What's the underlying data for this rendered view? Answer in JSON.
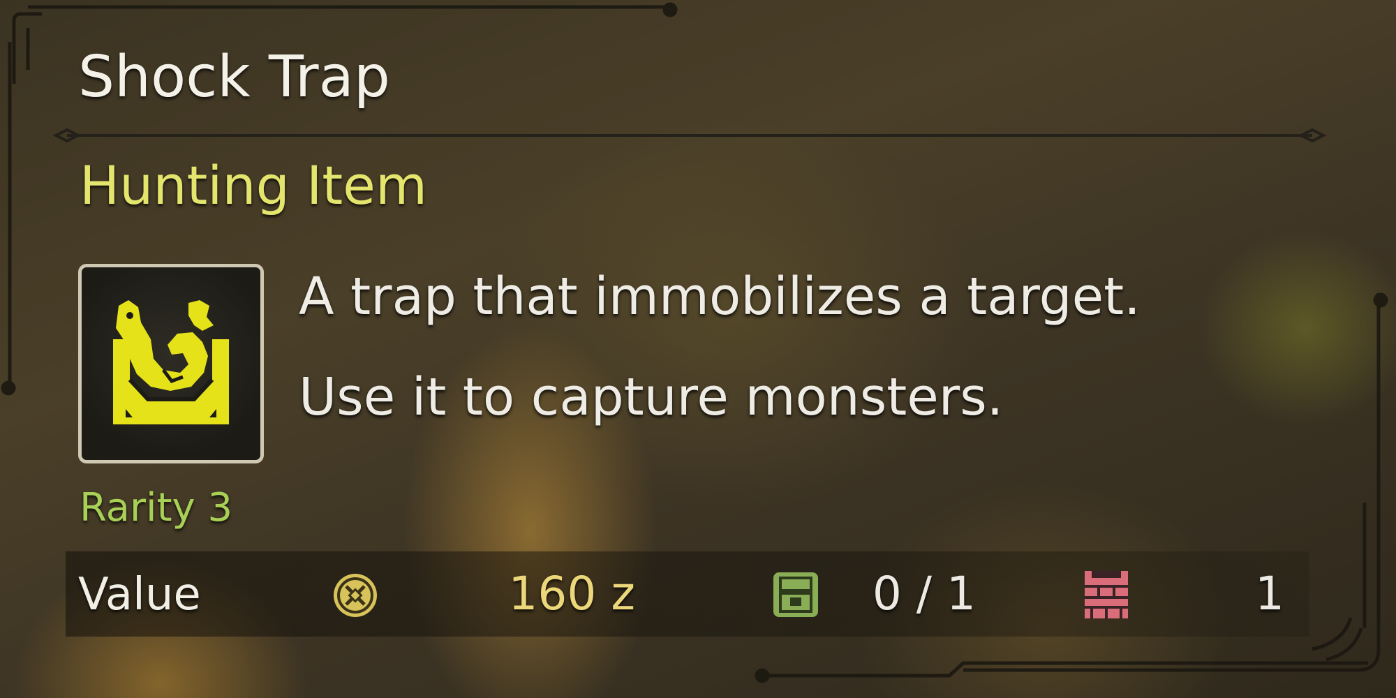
{
  "item": {
    "name": "Shock Trap",
    "category": "Hunting Item",
    "icon": "shock-trap-icon",
    "description_lines": [
      "A trap that immobilizes a target.",
      "Use it to capture monsters."
    ],
    "rarity": "Rarity 3"
  },
  "stats": {
    "value_label": "Value",
    "zenny_icon": "zenny-coin-icon",
    "value": "160 z",
    "pouch_icon": "item-pouch-icon",
    "pouch_count": "0 / 1",
    "box_icon": "item-box-icon",
    "box_count": "1"
  },
  "colors": {
    "title": "#f4f1e8",
    "category": "#e4e56d",
    "rarity": "#a8d056",
    "value": "#ecd77a",
    "icon_yellow": "#e6e21a",
    "pouch_icon": "#8aae55",
    "box_icon": "#d96e7a"
  }
}
